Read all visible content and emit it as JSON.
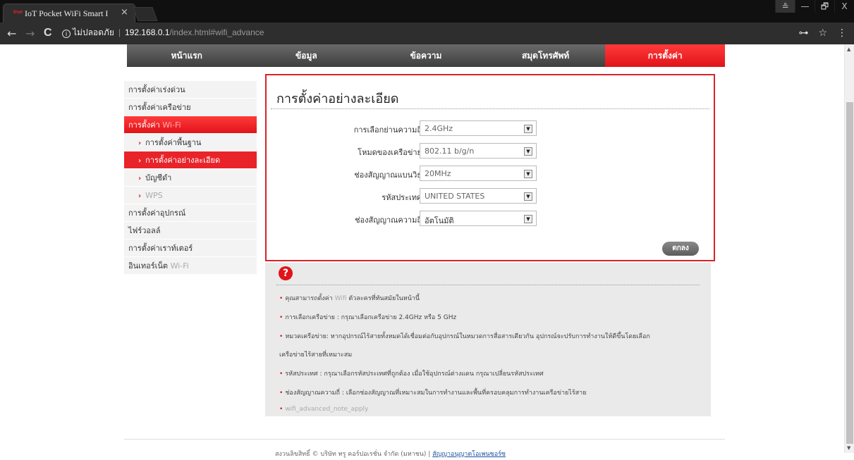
{
  "browser": {
    "tab_logo": "true",
    "tab_title": "IoT Pocket WiFi Smart I",
    "tab_close": "×",
    "security_label": "ไม่ปลอดภัย",
    "host": "192.168.0.1",
    "path": "/index.html#wifi_advance",
    "back": "←",
    "forward": "→",
    "reload": "C",
    "key_icon": "⊶",
    "star_icon": "☆",
    "menu_icon": "⋮",
    "win_profile": "≗",
    "win_min": "—",
    "win_max": "🗗",
    "win_close": "X"
  },
  "topnav": {
    "items": [
      "หน้าแรก",
      "ข้อมูล",
      "ข้อความ",
      "สมุดโทรศัพท์",
      "การตั้งค่า"
    ]
  },
  "sidebar": {
    "quick": "การตั้งค่าเร่งด่วน",
    "network": "การตั้งค่าเครือข่าย",
    "wifi_prefix": "การตั้งค่า ",
    "wifi_suffix": "Wi-Fi",
    "basic": "การตั้งค่าพื้นฐาน",
    "advanced": "การตั้งค่าอย่างละเอียด",
    "blacklist": "บัญชีดำ",
    "wps": "WPS",
    "device": "การตั้งค่าอุปกรณ์",
    "firewall": "ไฟร์วอลล์",
    "router": "การตั้งค่าเราท์เตอร์",
    "internet_prefix": "อินเทอร์เน็ต ",
    "internet_suffix": "Wi-Fi"
  },
  "panel": {
    "title": "การตั้งค่าอย่างละเอียด",
    "fields": [
      {
        "label": "การเลือกย่านความถี่",
        "value": "2.4GHz"
      },
      {
        "label": "โหมดของเครือข่าย",
        "value": "802.11 b/g/n"
      },
      {
        "label": "ช่องสัญญาณแบนวิธ",
        "value": "20MHz"
      },
      {
        "label": "รหัสประเทศ",
        "value": "UNITED STATES"
      },
      {
        "label": "ช่องสัญญาณความถี่",
        "value": "อัตโนมัติ"
      }
    ],
    "ok": "ตกลง"
  },
  "help": {
    "icon": "?",
    "l1_a": "คุณสามารถตั้งค่า ",
    "l1_b": "Wifi",
    "l1_c": " ตัวละครที่ทันสมัยในหน้านี้",
    "l2": "การเลือกเครือข่าย : กรุณาเลือกเครือข่าย 2.4GHz หรือ 5 GHz",
    "l3": "หมวดเครือข่าย: หากอุปกรณ์ไร้สายทั้งหมดได้เชื่อมต่อกับอุปกรณ์ในหมวดการสื่อสารเดียวกัน อุปกรณ์จะปรับการทำงานให้ดีขึ้นโดยเลือก",
    "l3b": "เครือข่ายไร้สายที่เหมาะสม",
    "l4": "รหัสประเทศ :  กรุณาเลือกรหัสประเทศที่ถูกต้อง เมื่อใช้อุปกรณ์ต่างแดน กรุณาเปลี่ยนรหัสประเทศ",
    "l5": "ช่องสัญญาณความถี่ : เลือกช่องสัญญาณที่เหมาะสมในการทำงานและพื้นที่ครอบคลุมการทำงานเครือข่ายไร้สาย",
    "l6": "wifi_advanced_note_apply",
    "bullet": "•"
  },
  "footer": {
    "copyright": "สงวนลิขสิทธิ์ © บริษัท ทรู คอร์ปอเรชั่น จำกัด (มหาชน)",
    "divider": " | ",
    "link": "สัญญาอนุญาตโอเพนซอร์ซ"
  },
  "arrow": "›",
  "dropdown_arrow": "▼"
}
